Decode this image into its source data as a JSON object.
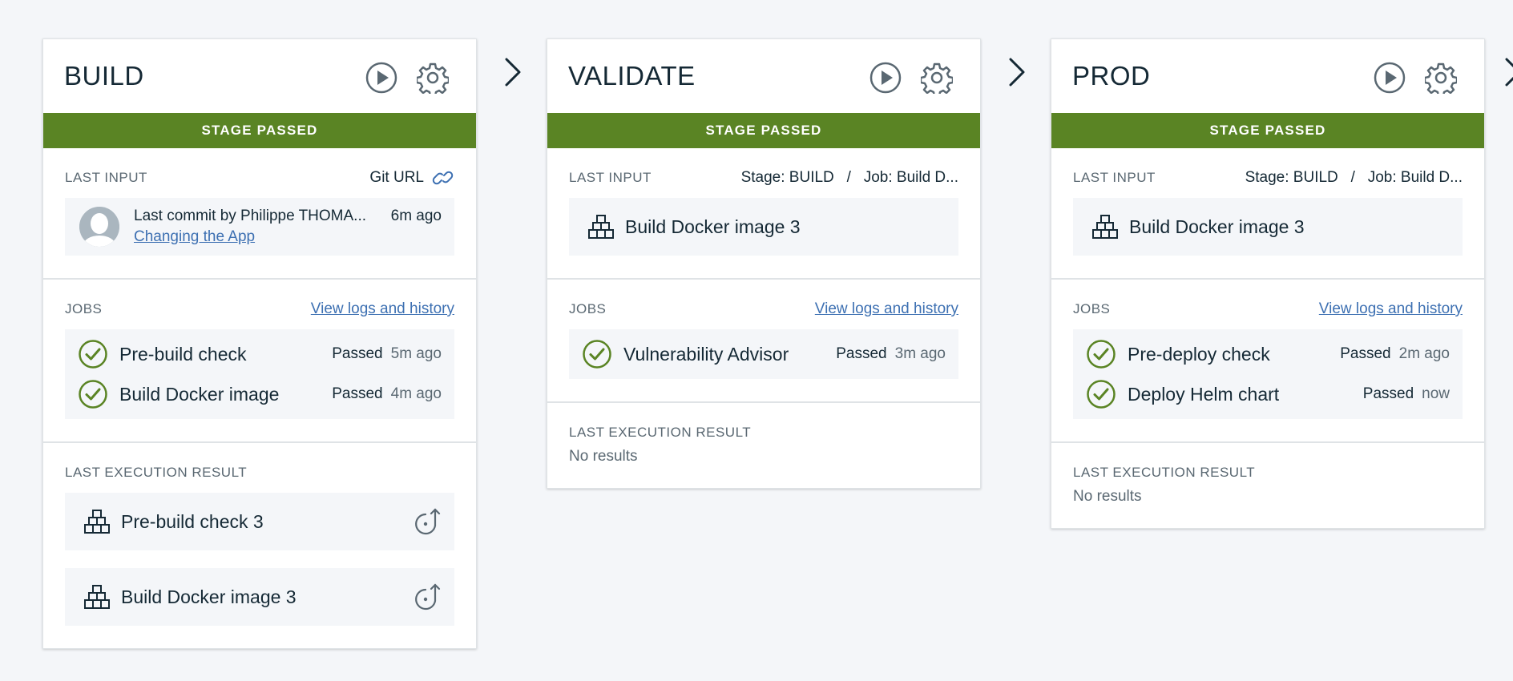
{
  "stages": [
    {
      "title": "BUILD",
      "status": "STAGE PASSED",
      "last_input_label": "LAST INPUT",
      "input_source": "Git URL",
      "commit_author": "Last commit by Philippe THOMA...",
      "commit_time": "6m ago",
      "commit_message": "Changing the App",
      "jobs_label": "JOBS",
      "jobs_link": "View logs and history",
      "jobs": [
        {
          "name": "Pre-build check",
          "status": "Passed",
          "time": "5m ago"
        },
        {
          "name": "Build Docker image",
          "status": "Passed",
          "time": "4m ago"
        }
      ],
      "result_label": "LAST EXECUTION RESULT",
      "results": [
        {
          "name": "Pre-build check 3"
        },
        {
          "name": "Build Docker image 3"
        }
      ]
    },
    {
      "title": "VALIDATE",
      "status": "STAGE PASSED",
      "last_input_label": "LAST INPUT",
      "input_ref": "Stage: BUILD   /   Job: Build D...",
      "input_item": "Build Docker image 3",
      "jobs_label": "JOBS",
      "jobs_link": "View logs and history",
      "jobs": [
        {
          "name": "Vulnerability Advisor",
          "status": "Passed",
          "time": "3m ago"
        }
      ],
      "result_label": "LAST EXECUTION RESULT",
      "no_results": "No results"
    },
    {
      "title": "PROD",
      "status": "STAGE PASSED",
      "last_input_label": "LAST INPUT",
      "input_ref": "Stage: BUILD   /   Job: Build D...",
      "input_item": "Build Docker image 3",
      "jobs_label": "JOBS",
      "jobs_link": "View logs and history",
      "jobs": [
        {
          "name": "Pre-deploy check",
          "status": "Passed",
          "time": "2m ago"
        },
        {
          "name": "Deploy Helm chart",
          "status": "Passed",
          "time": "now"
        }
      ],
      "result_label": "LAST EXECUTION RESULT",
      "no_results": "No results"
    }
  ],
  "icons": {
    "run": "play-icon",
    "settings": "gear-icon",
    "link": "link-icon",
    "passed": "check-circle-icon",
    "artifact": "stacked-boxes-icon",
    "redeploy": "redeploy-icon",
    "separator": "chevron-right-icon"
  },
  "colors": {
    "passed": "#5a8424",
    "link": "#3d70b2",
    "panel": "#f4f6f9",
    "background": "#f4f6f9",
    "icon": "#5a6872"
  }
}
